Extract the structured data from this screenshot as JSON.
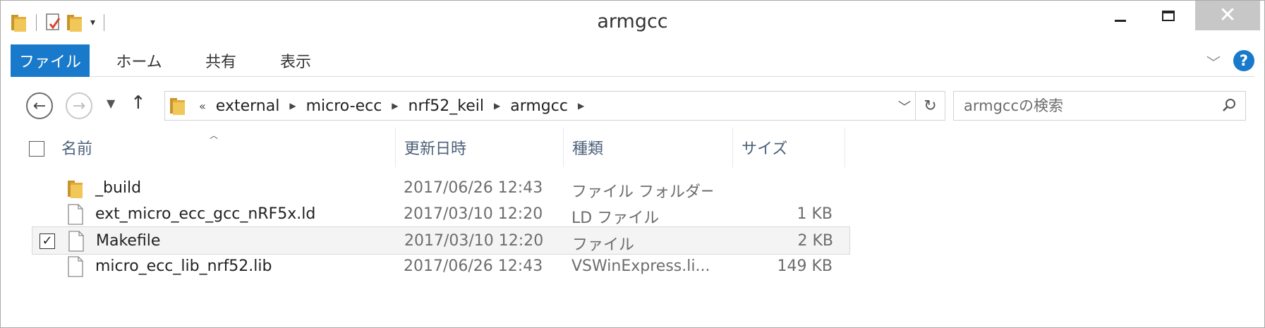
{
  "window": {
    "title": "armgcc"
  },
  "quick_access": {
    "icons": [
      "folder-icon",
      "properties-icon",
      "new-folder-icon",
      "customize-dropdown-icon"
    ]
  },
  "ribbon": {
    "tabs": [
      {
        "label": "ファイル",
        "active": true
      },
      {
        "label": "ホーム"
      },
      {
        "label": "共有"
      },
      {
        "label": "表示"
      }
    ],
    "help_label": "?"
  },
  "address": {
    "lead": "«",
    "segments": [
      "external",
      "micro-ecc",
      "nrf52_keil",
      "armgcc"
    ]
  },
  "search": {
    "placeholder": "armgccの検索"
  },
  "columns": {
    "name": "名前",
    "date": "更新日時",
    "type": "種類",
    "size": "サイズ"
  },
  "files": [
    {
      "name": "_build",
      "date": "2017/06/26 12:43",
      "type": "ファイル フォルダー",
      "size": "",
      "icon": "folder-icon",
      "checked": false,
      "selected": false
    },
    {
      "name": "ext_micro_ecc_gcc_nRF5x.ld",
      "date": "2017/03/10 12:20",
      "type": "LD ファイル",
      "size": "1 KB",
      "icon": "file-icon",
      "checked": false,
      "selected": false
    },
    {
      "name": "Makefile",
      "date": "2017/03/10 12:20",
      "type": "ファイル",
      "size": "2 KB",
      "icon": "file-icon",
      "checked": true,
      "selected": true
    },
    {
      "name": "micro_ecc_lib_nrf52.lib",
      "date": "2017/06/26 12:43",
      "type": "VSWinExpress.li...",
      "size": "149 KB",
      "icon": "file-icon",
      "checked": false,
      "selected": false
    }
  ],
  "colors": {
    "accent": "#1979ca",
    "header_text": "#4c607a",
    "folder": "#e8b93f"
  }
}
